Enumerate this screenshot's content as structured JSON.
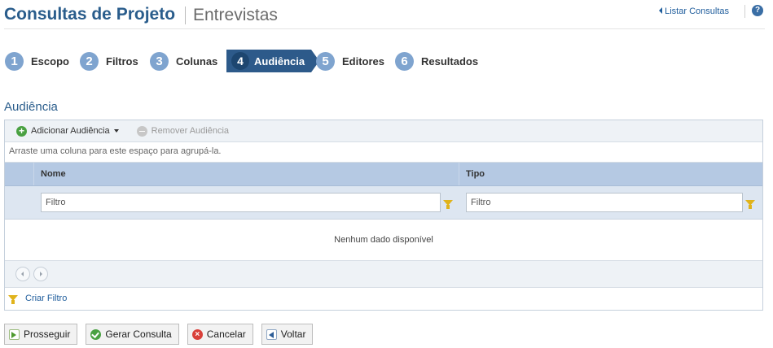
{
  "header": {
    "title": "Consultas de Projeto",
    "subtitle": "Entrevistas",
    "list_link": "Listar Consultas",
    "help": "?"
  },
  "steps": [
    {
      "num": "1",
      "label": "Escopo"
    },
    {
      "num": "2",
      "label": "Filtros"
    },
    {
      "num": "3",
      "label": "Colunas"
    },
    {
      "num": "4",
      "label": "Audiência",
      "active": true
    },
    {
      "num": "5",
      "label": "Editores"
    },
    {
      "num": "6",
      "label": "Resultados"
    }
  ],
  "section": {
    "title": "Audiência"
  },
  "grid": {
    "toolbar": {
      "add_label": "Adicionar Audiência",
      "remove_label": "Remover Audiência"
    },
    "group_hint": "Arraste uma coluna para este espaço para agrupá-la.",
    "columns": [
      "Nome",
      "Tipo"
    ],
    "filter_placeholders": [
      "Filtro",
      "Filtro"
    ],
    "empty_message": "Nenhum dado disponível",
    "create_filter": "Criar Filtro"
  },
  "actions": {
    "proceed": "Prosseguir",
    "generate": "Gerar Consulta",
    "cancel": "Cancelar",
    "back": "Voltar"
  },
  "colors": {
    "title": "#2a5d8c",
    "active_step": "#2d5a8a",
    "step_circle": "#7fa4cf",
    "column_header": "#b5c9e3"
  }
}
